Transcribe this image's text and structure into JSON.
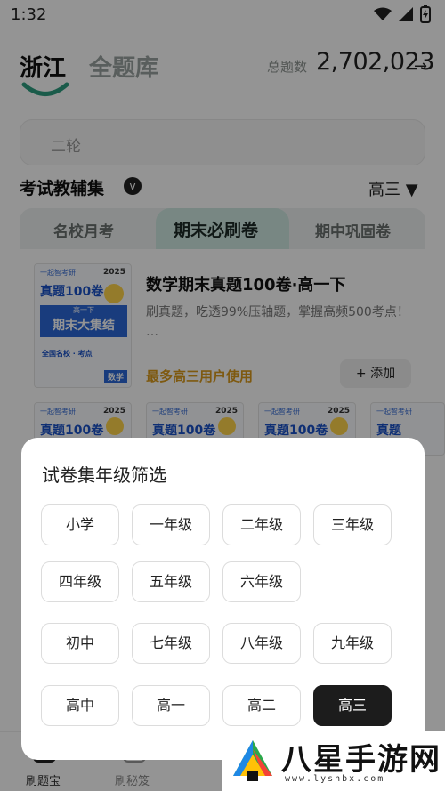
{
  "status": {
    "time": "1:32"
  },
  "header": {
    "region": "浙江",
    "library": "全题库",
    "total_label": "总题数",
    "total_count": "2,702,023",
    "total_arrow": "→"
  },
  "search": {
    "placeholder": "二轮"
  },
  "section": {
    "title": "考试教辅集",
    "badge": "v",
    "grade_selected": "高三 ▼"
  },
  "tabs": [
    {
      "label": "名校月考"
    },
    {
      "label": "期末必刷卷",
      "active": true
    },
    {
      "label": "期中巩固卷"
    }
  ],
  "book": {
    "title": "数学期末真题100卷·高一下",
    "description": "刷真题，吃透99%压轴题，掌握高频500考点！ …",
    "users": "最多高三用户使用",
    "add_label": "+ 添加",
    "cover": {
      "brand": "一起智考研",
      "year": "2025",
      "main": "真题100卷",
      "band_small": "高一下",
      "band_big": "期末大集结",
      "sub": "全国名校 · 考点",
      "subject": "数学"
    }
  },
  "thumbs": [
    {
      "brand": "一起智考研",
      "year": "2025",
      "main": "真题100卷"
    },
    {
      "brand": "一起智考研",
      "year": "2025",
      "main": "真题100卷"
    },
    {
      "brand": "一起智考研",
      "year": "2025",
      "main": "真题100卷"
    },
    {
      "brand": "一起智考研",
      "main": "真题"
    }
  ],
  "bottom_nav": [
    {
      "label": "刷题宝"
    },
    {
      "label": "刷秘笈"
    }
  ],
  "sheet": {
    "title": "试卷集年级筛选",
    "rows": [
      [
        "小学",
        "一年级",
        "二年级",
        "三年级"
      ],
      [
        "四年级",
        "五年级",
        "六年级"
      ],
      [
        "初中",
        "七年级",
        "八年级",
        "九年级"
      ],
      [
        "高中",
        "高一",
        "高二",
        "高三"
      ]
    ],
    "selected": "高三"
  },
  "watermark": {
    "text": "八星手游网",
    "url": "www.lyshbx.com"
  },
  "colors": {
    "accent_green": "#2e9e80",
    "selected_chip": "#1c1c1c",
    "users_gold": "#d99a1c"
  }
}
